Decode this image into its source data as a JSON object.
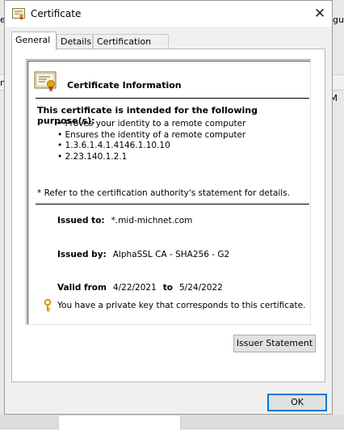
{
  "background": {
    "left_top_fragment": "eq",
    "left_mid_fragment": "n",
    "right_top_fragment": "gu",
    "right_mid_fragment": "M"
  },
  "dialog": {
    "title": "Certificate",
    "close_glyph": "✕",
    "tabs": [
      {
        "label": "General",
        "active": true
      },
      {
        "label": "Details",
        "active": false
      },
      {
        "label": "Certification Path",
        "active": false
      }
    ]
  },
  "cert": {
    "info_title": "Certificate Information",
    "purpose_heading": "This certificate is intended for the following purpose(s):",
    "purposes": [
      "Proves your identity to a remote computer",
      "Ensures the identity of a remote computer",
      "1.3.6.1.4.1.4146.1.10.10",
      "2.23.140.1.2.1"
    ],
    "refer_note": "* Refer to the certification authority's statement for details.",
    "issued_to_label": "Issued to:",
    "issued_to_value": "*.mid-michnet.com",
    "issued_by_label": "Issued by:",
    "issued_by_value": "AlphaSSL CA - SHA256 - G2",
    "valid_from_label": "Valid from",
    "valid_from_value": "4/22/2021",
    "valid_to_label": "to",
    "valid_to_value": "5/24/2022",
    "private_key_note": "You have a private key that corresponds to this certificate."
  },
  "buttons": {
    "issuer_statement": "Issuer Statement",
    "ok": "OK"
  },
  "colors": {
    "ok_focus": "#0078d7",
    "key_icon": "#e0a800",
    "seal_red": "#c0392b"
  },
  "icons": {
    "title": "certificate-icon",
    "cert_image": "certificate-ribbon-icon",
    "key": "key-icon",
    "close": "close-icon"
  }
}
